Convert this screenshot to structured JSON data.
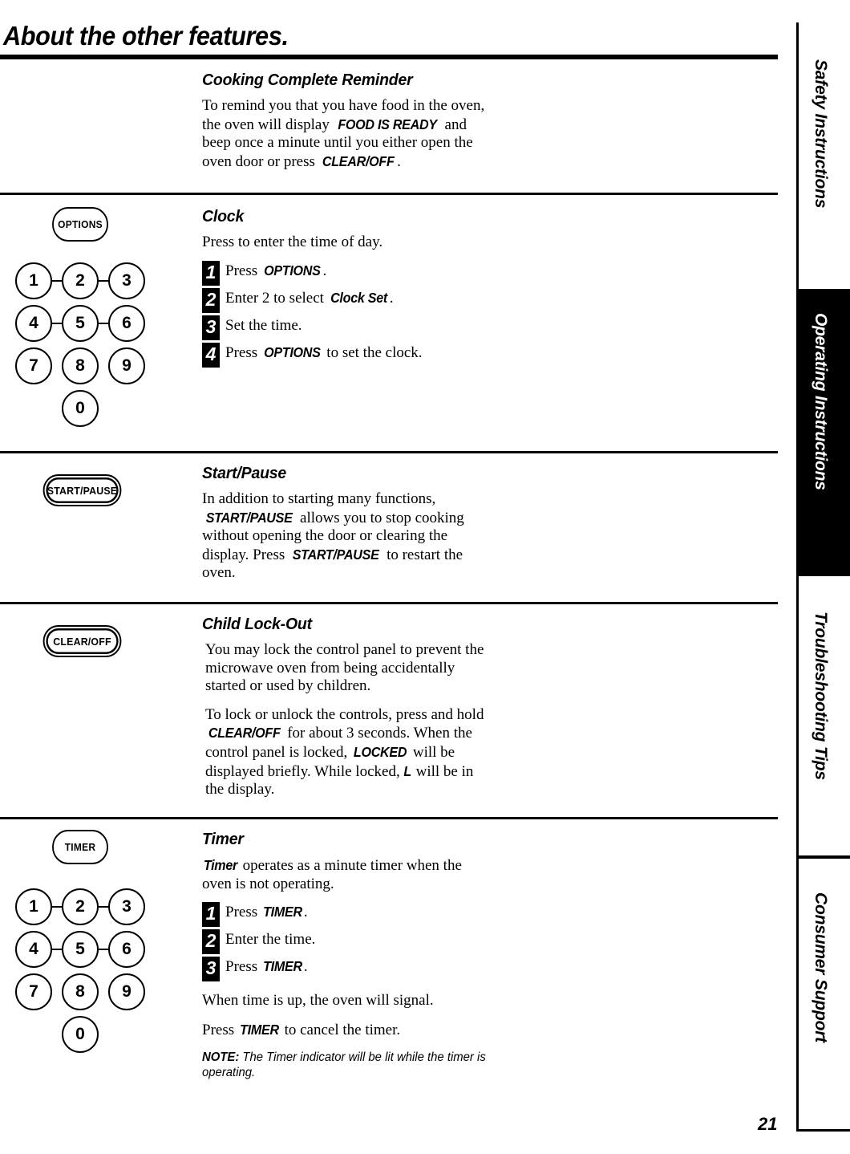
{
  "page": {
    "title": "About the other features.",
    "number": "21"
  },
  "rail": {
    "tabs": [
      {
        "label": "Safety Instructions",
        "active": false
      },
      {
        "label": "Operating Instructions",
        "active": true
      },
      {
        "label": "Troubleshooting Tips",
        "active": false
      },
      {
        "label": "Consumer Support",
        "active": false
      }
    ],
    "active_color": "#000000",
    "active_text_color": "#ffffff"
  },
  "sections": {
    "cooking_complete": {
      "heading": "Cooking Complete Reminder",
      "p1_a": "To remind you that you have food in the oven, the oven will display ",
      "p1_cmd1": "FOOD IS READY",
      "p1_b": " and beep once a minute until you either open the oven door or press ",
      "p1_cmd2": "CLEAR/OFF",
      "p1_c": "."
    },
    "clock": {
      "heading": "Clock",
      "intro": "Press to enter the time of day.",
      "keypad": {
        "function_key": "OPTIONS",
        "digits": [
          "1",
          "2",
          "3",
          "4",
          "5",
          "6",
          "7",
          "8",
          "9",
          "0"
        ]
      },
      "steps": [
        {
          "num": "1",
          "pre": "Press ",
          "cmd": "OPTIONS",
          "post": "."
        },
        {
          "num": "2",
          "pre": "Enter 2 to select ",
          "cmd": "Clock Set",
          "post": "."
        },
        {
          "num": "3",
          "pre": "Set the time.",
          "cmd": "",
          "post": ""
        },
        {
          "num": "4",
          "pre": "Press ",
          "cmd": "OPTIONS",
          "post": " to set the clock."
        }
      ]
    },
    "start_pause": {
      "heading": "Start/Pause",
      "button": "START/PAUSE",
      "p1_a": "In addition to starting many functions, ",
      "p1_cmd1": "START/PAUSE",
      "p1_b": " allows you to stop cooking without opening the door or clearing the display. Press ",
      "p1_cmd2": "START/PAUSE",
      "p1_c": " to restart the oven."
    },
    "child_lock": {
      "heading": "Child Lock-Out",
      "button": "CLEAR/OFF",
      "p1": "You may lock the control panel to prevent the microwave oven from being accidentally started or used by children.",
      "p2_a": "To lock or unlock the controls, press and hold ",
      "p2_cmd1": "CLEAR/OFF",
      "p2_b": " for about 3 seconds. When the control panel is locked, ",
      "p2_cmd2": "LOCKED",
      "p2_c": " will be displayed briefly. While locked, ",
      "p2_cmd3": "L",
      "p2_d": " will be in the display."
    },
    "timer": {
      "heading": "Timer",
      "keypad": {
        "function_key": "TIMER",
        "digits": [
          "1",
          "2",
          "3",
          "4",
          "5",
          "6",
          "7",
          "8",
          "9",
          "0"
        ]
      },
      "intro_cmd": "Timer",
      "intro_rest": " operates as a minute timer when the oven is not operating.",
      "steps": [
        {
          "num": "1",
          "pre": "Press ",
          "cmd": "TIMER",
          "post": "."
        },
        {
          "num": "2",
          "pre": "Enter the time.",
          "cmd": "",
          "post": ""
        },
        {
          "num": "3",
          "pre": "Press ",
          "cmd": "TIMER",
          "post": "."
        }
      ],
      "after1": "When time is up, the oven will signal.",
      "after2_a": "Press ",
      "after2_cmd": "TIMER",
      "after2_b": " to cancel the timer.",
      "note_label": "NOTE:",
      "note_text": " The Timer indicator will be lit while the timer is operating."
    }
  }
}
